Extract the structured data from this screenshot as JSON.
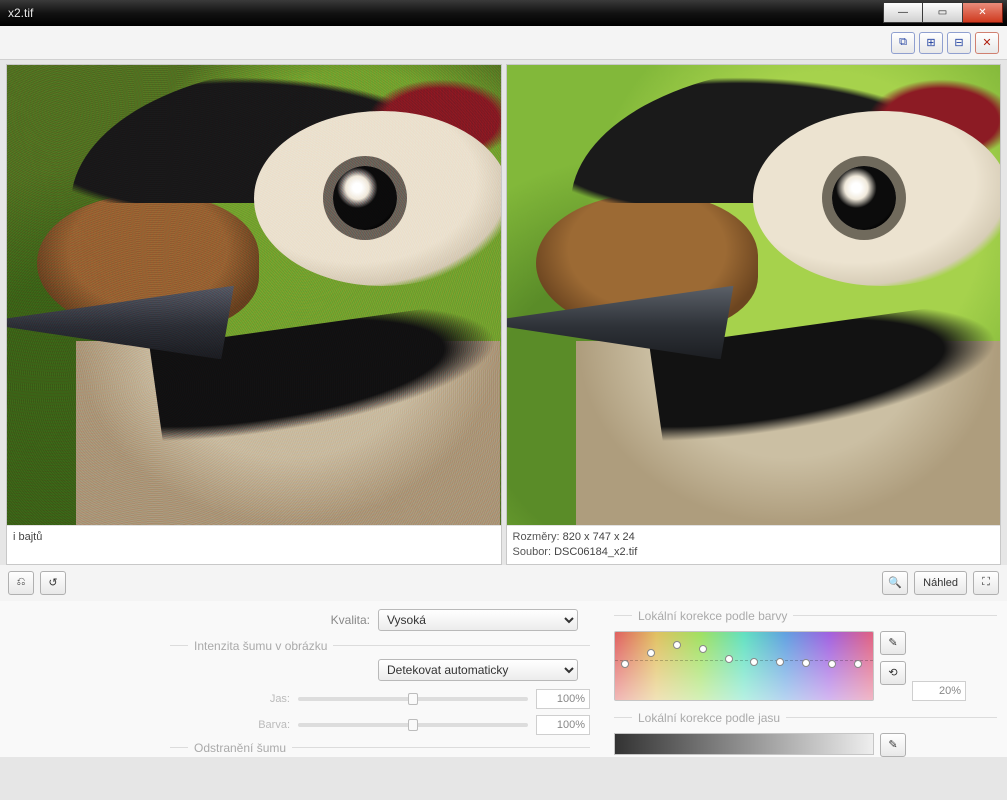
{
  "window": {
    "title": "x2.tif"
  },
  "toolbar_top": {
    "btn1": "⧉",
    "btn2": "⊞",
    "btn3": "⊟",
    "btn4": "✕"
  },
  "left_pane": {
    "footer": "i bajtů"
  },
  "right_pane": {
    "dim_label": "Rozměry:",
    "dim_value": "820 x 747 x 24",
    "file_label": "Soubor:",
    "file_value": "DSC06184_x2.tif"
  },
  "midbar": {
    "left_btn1": "⎌",
    "left_btn2": "↺",
    "preview_btn_icon": "🔍",
    "preview_btn_label": "Náhled",
    "right_btn": "⛶"
  },
  "settings": {
    "quality_label": "Kvalita:",
    "quality_value": "Vysoká",
    "noise_section": "Intenzita šumu v obrázku",
    "noise_mode": "Detekovat automaticky",
    "sl1_label": "Jas:",
    "sl1_pct": "100%",
    "sl2_label": "Barva:",
    "sl2_pct": "100%",
    "denoise_section": "Odstranění šumu",
    "hue_section": "Lokální korekce podle barvy",
    "hue_pct": "20%",
    "picker_icon": "✎",
    "reset_icon": "⟲",
    "lum_section": "Lokální korekce podle jasu"
  }
}
